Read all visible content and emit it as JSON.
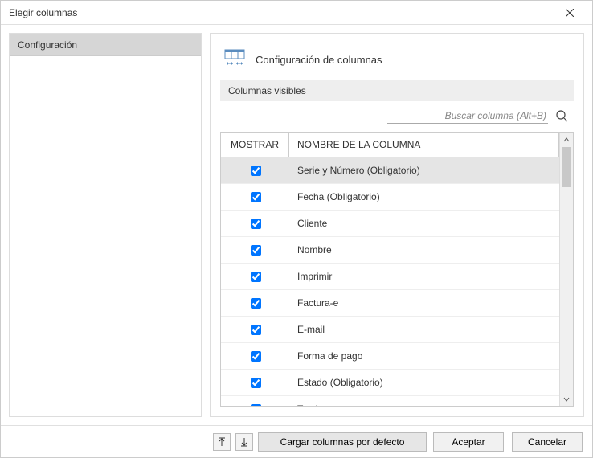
{
  "window": {
    "title": "Elegir columnas"
  },
  "sidebar": {
    "items": [
      {
        "label": "Configuración"
      }
    ]
  },
  "main": {
    "header_title": "Configuración de columnas",
    "subheader": "Columnas visibles",
    "search_placeholder": "Buscar columna (Alt+B)"
  },
  "table": {
    "col_mostrar": "MOSTRAR",
    "col_nombre": "NOMBRE DE LA COLUMNA",
    "rows": [
      {
        "checked": true,
        "name": "Serie y Número (Obligatorio)",
        "selected": true
      },
      {
        "checked": true,
        "name": "Fecha (Obligatorio)",
        "selected": false
      },
      {
        "checked": true,
        "name": "Cliente",
        "selected": false
      },
      {
        "checked": true,
        "name": "Nombre",
        "selected": false
      },
      {
        "checked": true,
        "name": "Imprimir",
        "selected": false
      },
      {
        "checked": true,
        "name": "Factura-e",
        "selected": false
      },
      {
        "checked": true,
        "name": "E-mail",
        "selected": false
      },
      {
        "checked": true,
        "name": "Forma de pago",
        "selected": false
      },
      {
        "checked": true,
        "name": "Estado (Obligatorio)",
        "selected": false
      },
      {
        "checked": true,
        "name": "Total",
        "selected": false
      }
    ]
  },
  "footer": {
    "load_defaults": "Cargar columnas por defecto",
    "accept": "Aceptar",
    "cancel": "Cancelar"
  }
}
